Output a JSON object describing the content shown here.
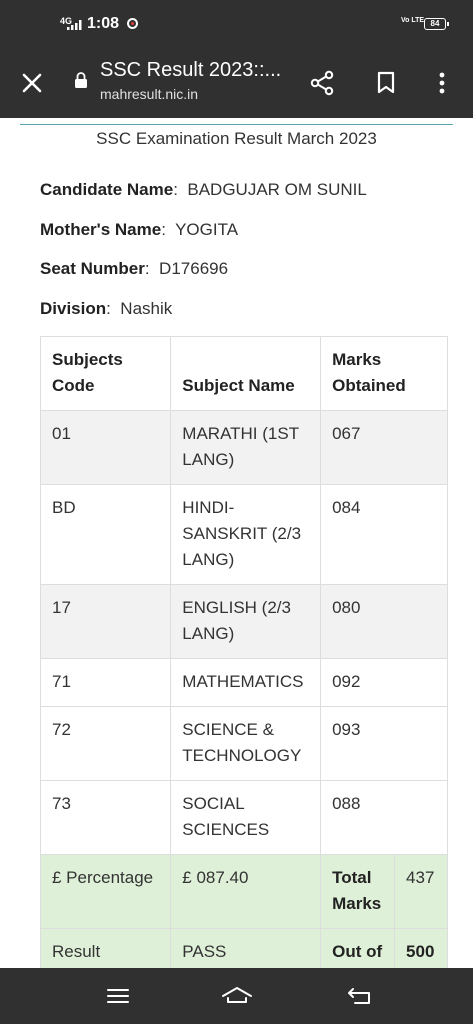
{
  "status_bar": {
    "network": "4G",
    "time": "1:08",
    "volte": "Vo LTE",
    "battery": "84"
  },
  "browser": {
    "title": "SSC Result 2023::...",
    "url": "mahresult.nic.in",
    "icons": [
      "close-icon",
      "lock-icon",
      "share-icon",
      "bookmark-icon",
      "more-vert-icon"
    ]
  },
  "result": {
    "exam_title": "SSC Examination Result March 2023",
    "candidate_label": "Candidate Name",
    "candidate_value": "BADGUJAR OM SUNIL",
    "mother_label": "Mother's Name",
    "mother_value": "YOGITA",
    "seat_label": "Seat Number",
    "seat_value": "D176696",
    "division_label": "Division",
    "division_value": "Nashik"
  },
  "table": {
    "headers": [
      "Subjects Code",
      "Subject Name",
      "Marks Obtained"
    ],
    "rows": [
      {
        "code": "01",
        "name": "MARATHI (1ST LANG)",
        "marks": "067"
      },
      {
        "code": "BD",
        "name": "HINDI-SANSKRIT (2/3 LANG)",
        "marks": "084"
      },
      {
        "code": "17",
        "name": "ENGLISH (2/3 LANG)",
        "marks": "080"
      },
      {
        "code": "71",
        "name": "MATHEMATICS",
        "marks": "092"
      },
      {
        "code": "72",
        "name": "SCIENCE & TECHNOLOGY",
        "marks": "093"
      },
      {
        "code": "73",
        "name": "SOCIAL SCIENCES",
        "marks": "088"
      }
    ],
    "summary": [
      {
        "label": "£ Percentage",
        "value": "£ 087.40",
        "key": "Total Marks",
        "num": "437"
      },
      {
        "label": "Result",
        "value": "PASS",
        "key": "Out of",
        "num": "500"
      }
    ],
    "colors": {
      "row_alt": "#f2f2f2",
      "summary_bg": "#dff0d8",
      "border": "#dddddd"
    }
  },
  "nav_bar": {
    "icons": [
      "menu-icon",
      "home-icon",
      "back-icon"
    ]
  }
}
